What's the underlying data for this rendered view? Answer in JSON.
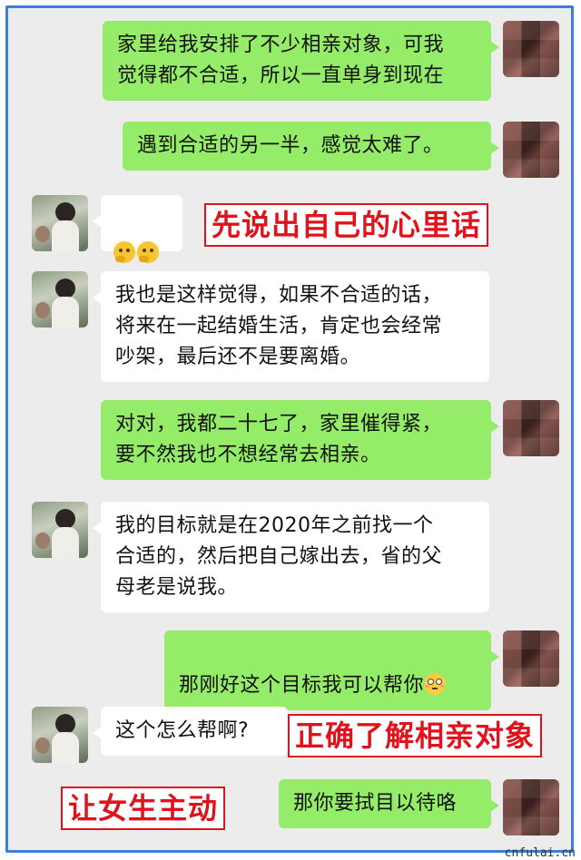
{
  "messages": [
    {
      "side": "me",
      "text": "家里给我安排了不少相亲对象，可我\n觉得都不合适，所以一直单身到现在"
    },
    {
      "side": "me",
      "text": "遇到合适的另一半，感觉太难了。"
    },
    {
      "side": "her",
      "emojis": [
        "thinking-face-icon",
        "thinking-face-icon"
      ]
    },
    {
      "side": "her",
      "text": "我也是这样觉得，如果不合适的话，\n将来在一起结婚生活，肯定也会经常\n吵架，最后还不是要离婚。"
    },
    {
      "side": "me",
      "text": "对对，我都二十七了，家里催得紧，\n要不然我也不想经常去相亲。"
    },
    {
      "side": "her",
      "text": "我的目标就是在2020年之前找一个\n合适的，然后把自己嫁出去，省的父\n母老是说我。"
    },
    {
      "side": "me",
      "text": "那刚好这个目标我可以帮你",
      "emoji": "flushed-face-icon"
    },
    {
      "side": "her",
      "text": "这个怎么帮啊?"
    },
    {
      "side": "me",
      "text": "那你要拭目以待咯"
    }
  ],
  "callouts": {
    "c1": "先说出自己的心里话",
    "c2": "正确了解相亲对象",
    "c3": "让女生主动"
  },
  "watermark": "cnfulai.cn",
  "colors": {
    "frame": "#3d7fd8",
    "my_bubble": "#95ec69",
    "her_bubble": "#ffffff",
    "callout": "#e0131c",
    "background": "#ececec"
  }
}
